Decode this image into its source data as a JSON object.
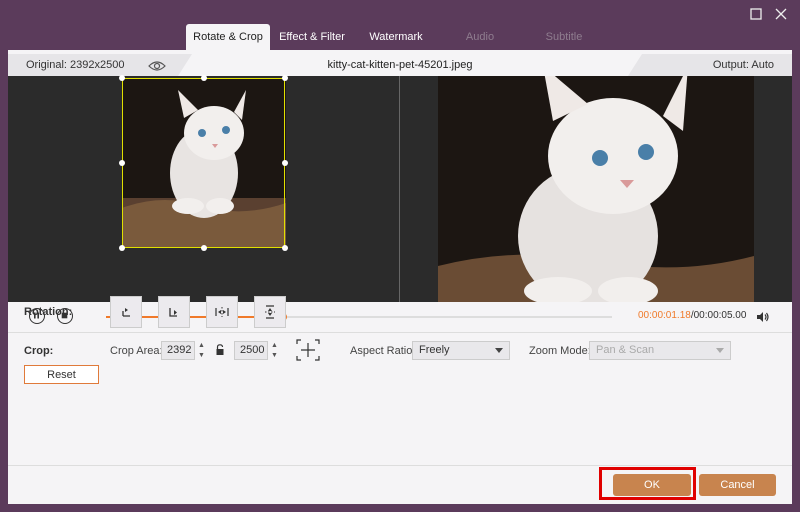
{
  "window": {
    "maximize_icon": "maximize-icon",
    "close_icon": "close-icon"
  },
  "tabs": [
    {
      "label": "Rotate & Crop",
      "state": "active"
    },
    {
      "label": "Effect & Filter",
      "state": "normal"
    },
    {
      "label": "Watermark",
      "state": "normal"
    },
    {
      "label": "Audio",
      "state": "disabled"
    },
    {
      "label": "Subtitle",
      "state": "disabled"
    }
  ],
  "info": {
    "original": "Original: 2392x2500",
    "filename": "kitty-cat-kitten-pet-45201.jpeg",
    "output": "Output: Auto"
  },
  "playback": {
    "current_time": "00:00:01.18",
    "total_time": "/00:00:05.00",
    "progress": 0.35
  },
  "rotation": {
    "label": "Rotation:"
  },
  "crop": {
    "label": "Crop:",
    "area_label": "Crop Area:",
    "width": "2392",
    "height": "2500",
    "aspect_label": "Aspect Ratio:",
    "aspect_value": "Freely",
    "zoom_label": "Zoom Mode:",
    "zoom_value": "Pan & Scan",
    "reset_label": "Reset"
  },
  "footer": {
    "ok_label": "OK",
    "cancel_label": "Cancel"
  },
  "colors": {
    "accent": "#f07a2a",
    "button": "#c8844e",
    "highlight": "#e00000",
    "window_bg": "#5b3b5b"
  }
}
